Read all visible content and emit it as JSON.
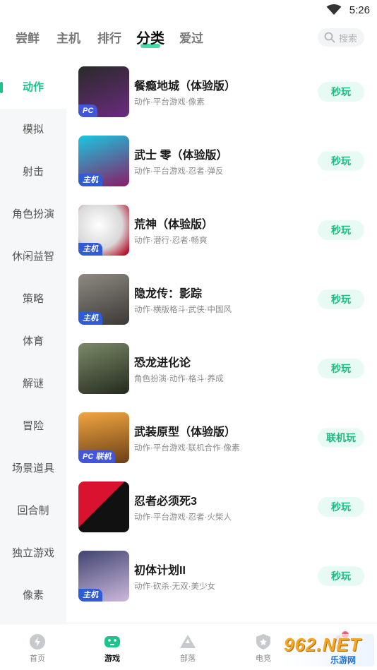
{
  "status_bar": {
    "time": "5:26"
  },
  "top_tabs": [
    {
      "label": "尝鲜",
      "active": false
    },
    {
      "label": "主机",
      "active": false
    },
    {
      "label": "排行",
      "active": false
    },
    {
      "label": "分类",
      "active": true
    },
    {
      "label": "爱过",
      "active": false
    }
  ],
  "search": {
    "placeholder": "搜索"
  },
  "sidebar": {
    "items": [
      {
        "label": "动作",
        "active": true
      },
      {
        "label": "模拟"
      },
      {
        "label": "射击"
      },
      {
        "label": "角色扮演"
      },
      {
        "label": "休闲益智"
      },
      {
        "label": "策略"
      },
      {
        "label": "体育"
      },
      {
        "label": "解谜"
      },
      {
        "label": "冒险"
      },
      {
        "label": "场景道具"
      },
      {
        "label": "回合制"
      },
      {
        "label": "独立游戏"
      },
      {
        "label": "像素"
      }
    ]
  },
  "games": [
    {
      "title": "餐瘾地城（体验版）",
      "tags": "动作·平台游戏·像素",
      "badge": "PC",
      "button": "秒玩",
      "cover_colors": [
        "#1b1b1b",
        "#7b2d8c"
      ]
    },
    {
      "title": "武士 零（体验版）",
      "tags": "动作·平台游戏·忍者·弹反",
      "badge": "主机",
      "button": "秒玩",
      "cover_colors": [
        "#1fd0e6",
        "#7a1a5c"
      ]
    },
    {
      "title": "荒神（体验版）",
      "tags": "动作·潜行·忍者·畅爽",
      "badge": "主机",
      "button": "秒玩",
      "cover_colors": [
        "#f0f0f0",
        "#c0102a"
      ]
    },
    {
      "title": "隐龙传：影踪",
      "tags": "动作·横版格斗·武侠·中国风",
      "badge": "主机",
      "button": "秒玩",
      "cover_colors": [
        "#6d6a66",
        "#3c3a38"
      ]
    },
    {
      "title": "恐龙进化论",
      "tags": "角色扮演·动作·格斗·养成",
      "badge": "",
      "button": "秒玩",
      "cover_colors": [
        "#5b6a4a",
        "#2c3324"
      ]
    },
    {
      "title": "武装原型（体验版）",
      "tags": "动作·平台游戏·联机合作·像素",
      "badge": "PC 联机",
      "button": "联机玩",
      "cover_colors": [
        "#d8923a",
        "#5a3a1a"
      ]
    },
    {
      "title": "忍者必须死3",
      "tags": "动作·平台游戏·忍者·火柴人",
      "badge": "",
      "button": "秒玩",
      "cover_colors": [
        "#c8102e",
        "#111111"
      ]
    },
    {
      "title": "初体计划II",
      "tags": "动作·砍杀·无双·美少女",
      "badge": "主机",
      "button": "秒玩",
      "cover_colors": [
        "#4a4f7a",
        "#c9b6d9"
      ]
    }
  ],
  "bottom_nav": [
    {
      "label": "首页",
      "icon": "home-icon",
      "active": false
    },
    {
      "label": "游戏",
      "icon": "gamepad-icon",
      "active": true
    },
    {
      "label": "部落",
      "icon": "tribe-icon",
      "active": false
    },
    {
      "label": "电竞",
      "icon": "esports-shield-icon",
      "active": false
    },
    {
      "label": "",
      "icon": "profile-icon",
      "active": false
    }
  ],
  "watermark": {
    "main": "962.NET",
    "sub": "乐游网"
  },
  "colors": {
    "accent": "#1fc28a",
    "button_bg": "#e7faf3"
  }
}
